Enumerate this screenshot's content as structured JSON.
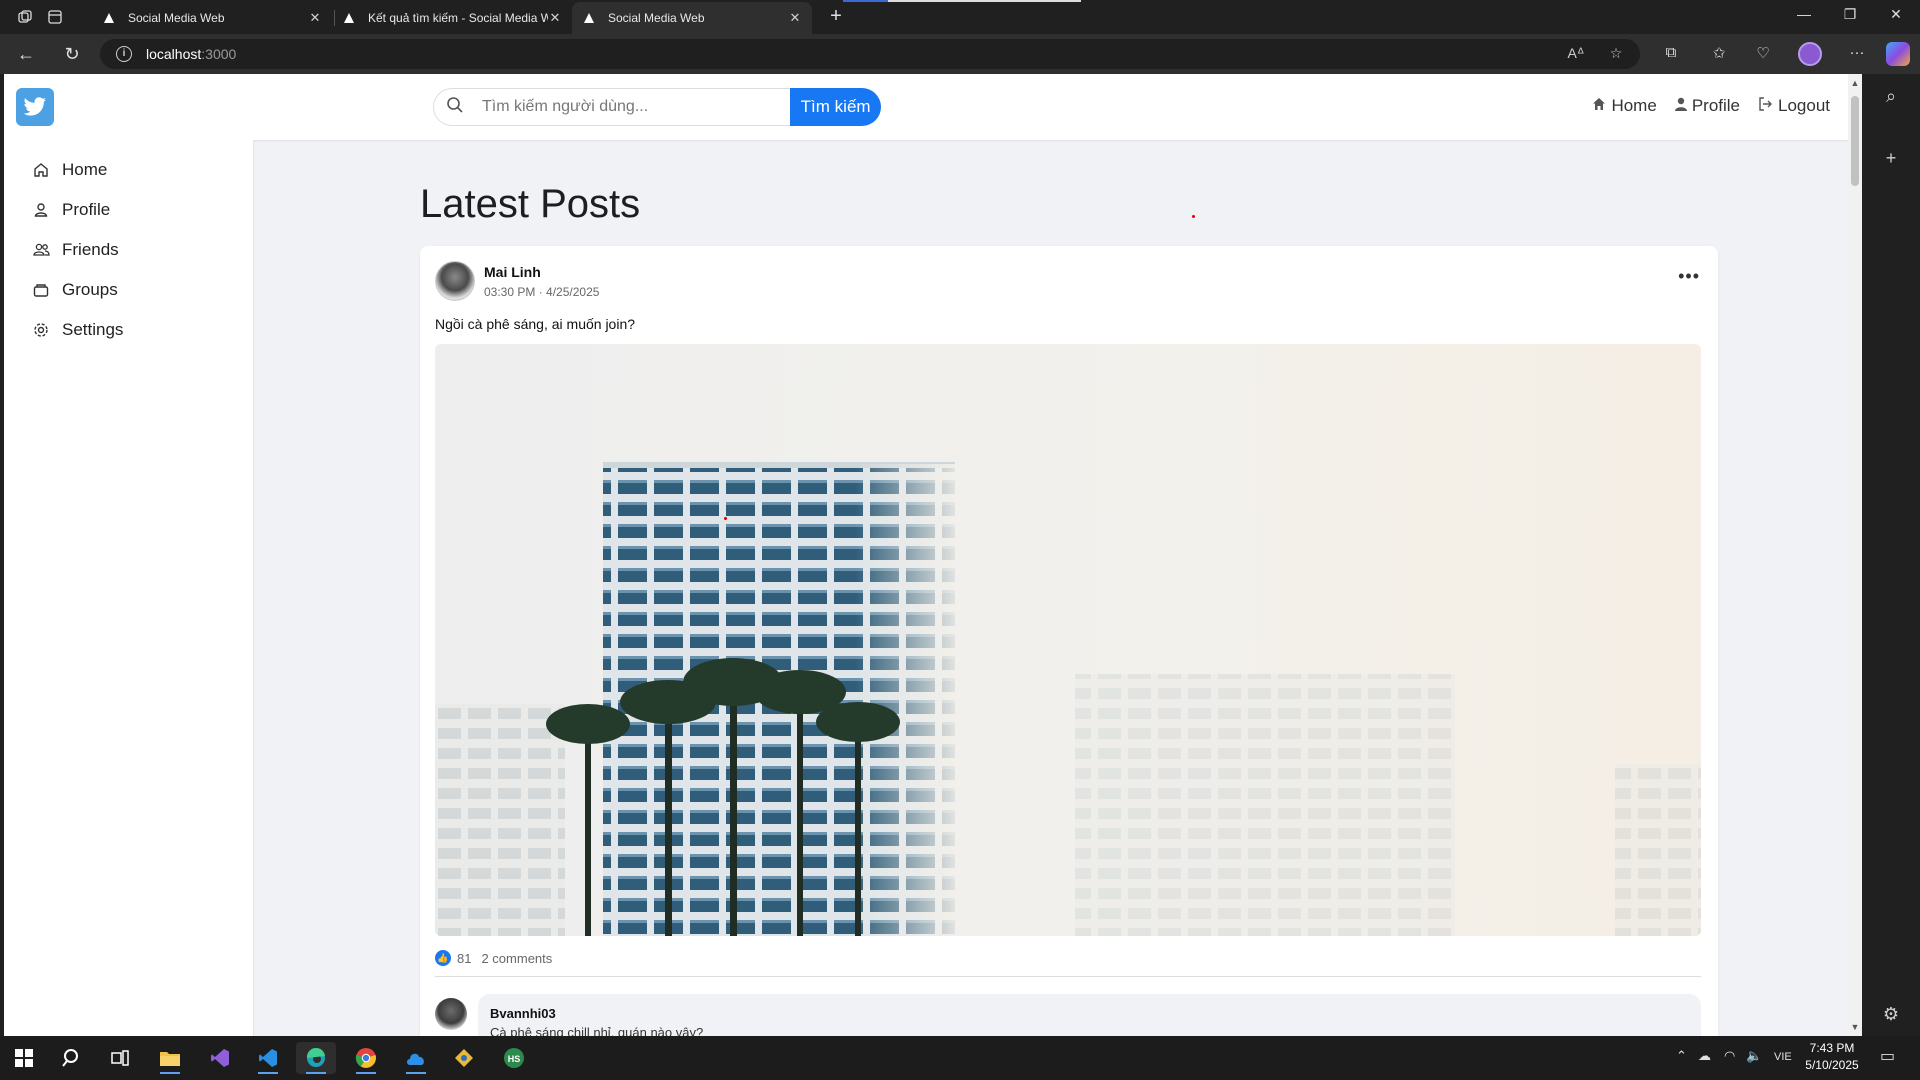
{
  "browser": {
    "tabs": [
      {
        "title": "Social Media Web"
      },
      {
        "title": "Kết quả tìm kiếm - Social Media W"
      },
      {
        "title": "Social Media Web"
      }
    ],
    "url_host": "localhost",
    "url_port": ":3000"
  },
  "header": {
    "search_placeholder": "Tìm kiếm người dùng...",
    "search_button": "Tìm kiếm",
    "nav": [
      {
        "label": "Home",
        "icon": "home-icon"
      },
      {
        "label": "Profile",
        "icon": "user-icon"
      },
      {
        "label": "Logout",
        "icon": "logout-icon"
      }
    ]
  },
  "sidebar": {
    "items": [
      {
        "label": "Home",
        "icon": "home-outline-icon"
      },
      {
        "label": "Profile",
        "icon": "user-outline-icon"
      },
      {
        "label": "Friends",
        "icon": "friends-icon"
      },
      {
        "label": "Groups",
        "icon": "groups-icon"
      },
      {
        "label": "Settings",
        "icon": "settings-icon"
      }
    ]
  },
  "main": {
    "title": "Latest Posts",
    "post": {
      "author": "Mai Linh",
      "time": "03:30 PM · 4/25/2025",
      "text": "Ngồi cà phê sáng, ai muốn join?",
      "likes": "81",
      "comments_count": "2 comments",
      "comment": {
        "author": "Bvannhi03",
        "text": "Cà phê sáng chill nhỉ, quán nào vậy?"
      }
    }
  },
  "taskbar": {
    "lang": "VIE",
    "time": "7:43 PM",
    "date": "5/10/2025"
  },
  "colors": {
    "accent": "#1877f2",
    "logo": "#4ca0e4",
    "page_bg": "#f0f2f5"
  }
}
